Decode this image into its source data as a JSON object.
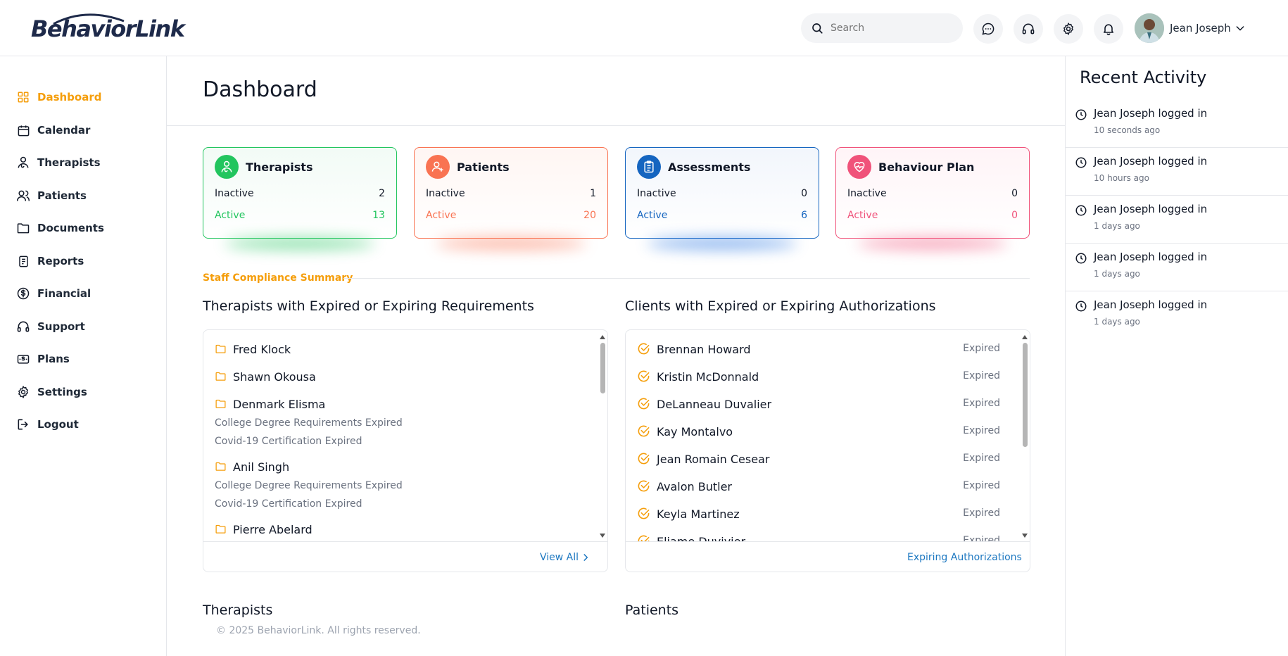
{
  "brand": {
    "name": "BehaviorLink"
  },
  "header": {
    "search_placeholder": "Search",
    "user_name": "Jean Joseph"
  },
  "sidebar": {
    "items": [
      {
        "label": "Dashboard",
        "icon": "grid-icon",
        "active": true
      },
      {
        "label": "Calendar",
        "icon": "calendar-icon"
      },
      {
        "label": "Therapists",
        "icon": "therapist-icon"
      },
      {
        "label": "Patients",
        "icon": "users-icon"
      },
      {
        "label": "Documents",
        "icon": "folder-icon"
      },
      {
        "label": "Reports",
        "icon": "report-icon"
      },
      {
        "label": "Financial",
        "icon": "dollar-icon"
      },
      {
        "label": "Support",
        "icon": "headphones-icon"
      },
      {
        "label": "Plans",
        "icon": "plans-icon"
      },
      {
        "label": "Settings",
        "icon": "gear-icon"
      },
      {
        "label": "Logout",
        "icon": "logout-icon"
      }
    ]
  },
  "page": {
    "title": "Dashboard"
  },
  "cards": [
    {
      "title": "Therapists",
      "inactive_label": "Inactive",
      "inactive": "2",
      "active_label": "Active",
      "active": "13",
      "color": "#22c55e"
    },
    {
      "title": "Patients",
      "inactive_label": "Inactive",
      "inactive": "1",
      "active_label": "Active",
      "active": "20",
      "color": "#f97352"
    },
    {
      "title": "Assessments",
      "inactive_label": "Inactive",
      "inactive": "0",
      "active_label": "Active",
      "active": "6",
      "color": "#1565c0"
    },
    {
      "title": "Behaviour Plan",
      "inactive_label": "Inactive",
      "inactive": "0",
      "active_label": "Active",
      "active": "0",
      "color": "#f0527a"
    }
  ],
  "compliance": {
    "section_label": "Staff Compliance Summary",
    "therapists_title": "Therapists with Expired or Expiring Requirements",
    "therapists": [
      {
        "name": "Fred Klock",
        "issues": []
      },
      {
        "name": "Shawn Okousa",
        "issues": []
      },
      {
        "name": "Denmark Elisma",
        "issues": [
          "College Degree Requirements Expired",
          "Covid-19 Certification Expired"
        ]
      },
      {
        "name": "Anil Singh",
        "issues": [
          "College Degree Requirements Expired",
          "Covid-19 Certification Expired"
        ]
      },
      {
        "name": "Pierre Abelard",
        "issues": []
      }
    ],
    "view_all": "View All",
    "clients_title": "Clients with Expired or Expiring Authorizations",
    "clients": [
      {
        "name": "Brennan Howard",
        "status": "Expired"
      },
      {
        "name": "Kristin McDonnald",
        "status": "Expired"
      },
      {
        "name": "DeLanneau Duvalier",
        "status": "Expired"
      },
      {
        "name": "Kay Montalvo",
        "status": "Expired"
      },
      {
        "name": "Jean Romain Cesear",
        "status": "Expired"
      },
      {
        "name": "Avalon Butler",
        "status": "Expired"
      },
      {
        "name": "Keyla Martinez",
        "status": "Expired"
      },
      {
        "name": "Eliame Duvivier",
        "status": "Expired"
      }
    ],
    "expiring_link": "Expiring Authorizations"
  },
  "bottom": {
    "therapists": "Therapists",
    "patients": "Patients"
  },
  "footer": {
    "copyright": "© 2025 BehaviorLink. All rights reserved."
  },
  "recent_activity": {
    "title": "Recent Activity",
    "items": [
      {
        "text": "Jean Joseph logged in",
        "time": "10 seconds ago"
      },
      {
        "text": "Jean Joseph logged in",
        "time": "10 hours ago"
      },
      {
        "text": "Jean Joseph logged in",
        "time": "1 days ago"
      },
      {
        "text": "Jean Joseph logged in",
        "time": "1 days ago"
      },
      {
        "text": "Jean Joseph logged in",
        "time": "1 days ago"
      }
    ]
  },
  "colors": {
    "accent": "#f59e0b",
    "link": "#1d78c1"
  }
}
